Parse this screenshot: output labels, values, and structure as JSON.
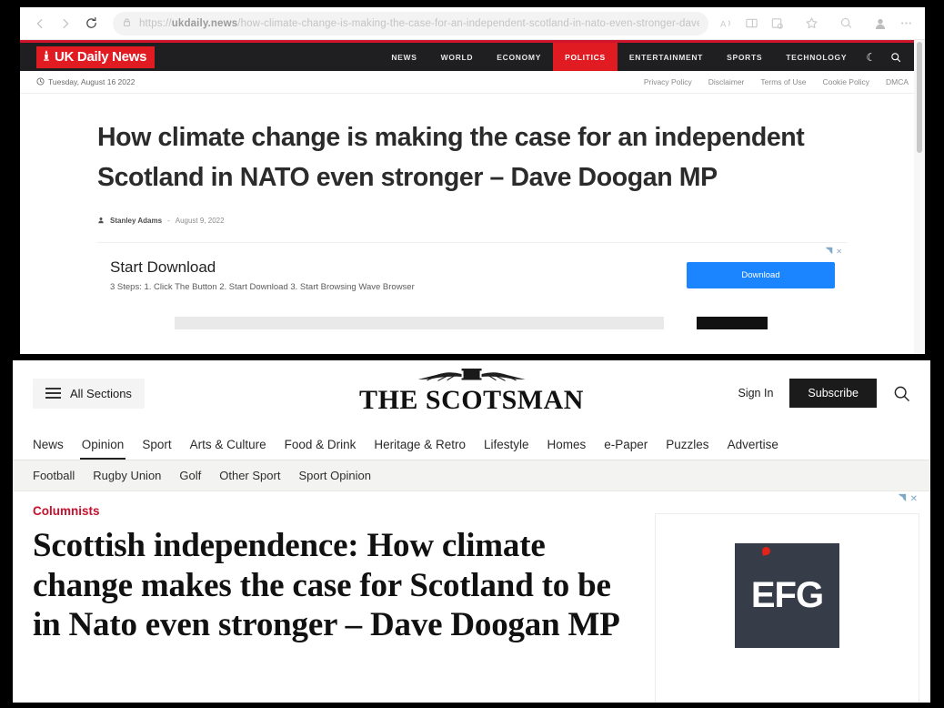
{
  "browser": {
    "back_label": "Back",
    "forward_label": "Forward",
    "reload_label": "Refresh",
    "url_prefix": "https://",
    "url_domain": "ukdaily.news",
    "url_path": "/how-climate-change-is-making-the-case-for-an-independent-scotland-in-nato-even-stronger-dave-do…",
    "icons": {
      "lock": "site-information",
      "read_aloud": "Aᵃ",
      "split_screen": "split-screen",
      "collections": "collections",
      "favorite": "add-favorite",
      "essentials": "browser-essentials",
      "profile": "profile",
      "settings": "…"
    }
  },
  "ukdaily": {
    "logo_text": "UK Daily News",
    "nav": [
      {
        "label": "NEWS",
        "active": false
      },
      {
        "label": "WORLD",
        "active": false
      },
      {
        "label": "ECONOMY",
        "active": false
      },
      {
        "label": "POLITICS",
        "active": true
      },
      {
        "label": "ENTERTAINMENT",
        "active": false
      },
      {
        "label": "SPORTS",
        "active": false
      },
      {
        "label": "TECHNOLOGY",
        "active": false
      }
    ],
    "nav_icons": {
      "dark_mode": "☾",
      "search": "search-icon"
    },
    "date": "Tuesday, August 16 2022",
    "policy_links": [
      "Privacy Policy",
      "Disclaimer",
      "Terms of Use",
      "Cookie Policy",
      "DMCA"
    ],
    "headline": "How climate change is making the case for an independent Scotland in NATO even stronger – Dave Doogan MP",
    "author": "Stanley Adams",
    "byline_sep": "-",
    "date_published": "August 9, 2022",
    "ad": {
      "title": "Start Download",
      "subtitle": "3 Steps: 1. Click The Button 2. Start Download 3. Start Browsing Wave Browser",
      "button": "Download",
      "badge": "ⓘ ✕"
    }
  },
  "scotsman": {
    "all_sections_label": "All Sections",
    "masthead": "THE SCOTSMAN",
    "sign_in": "Sign In",
    "subscribe": "Subscribe",
    "search_label": "Search",
    "nav": [
      {
        "label": "News",
        "active": false
      },
      {
        "label": "Opinion",
        "active": true
      },
      {
        "label": "Sport",
        "active": false
      },
      {
        "label": "Arts & Culture",
        "active": false
      },
      {
        "label": "Food & Drink",
        "active": false
      },
      {
        "label": "Heritage & Retro",
        "active": false
      },
      {
        "label": "Lifestyle",
        "active": false
      },
      {
        "label": "Homes",
        "active": false
      },
      {
        "label": "e-Paper",
        "active": false
      },
      {
        "label": "Puzzles",
        "active": false
      },
      {
        "label": "Advertise",
        "active": false
      }
    ],
    "subnav": [
      "Football",
      "Rugby Union",
      "Golf",
      "Other Sport",
      "Sport Opinion"
    ],
    "kicker": "Columnists",
    "headline": "Scottish independence: How climate change makes the case for Scotland to be in Nato even stronger – Dave Doogan MP",
    "ad": {
      "brand": "EFG",
      "badge": "ⓘ ✕"
    }
  },
  "colors": {
    "ukdaily_red": "#e11b22",
    "ukdaily_dark": "#1f1f22",
    "edge_rule_red": "#d0142c",
    "ad_blue": "#1a85ff",
    "scotsman_kicker_red": "#c8102e",
    "subscribe_black": "#1b1b1b",
    "efg_navy": "#363c48",
    "efg_dot_red": "#e2231a"
  }
}
